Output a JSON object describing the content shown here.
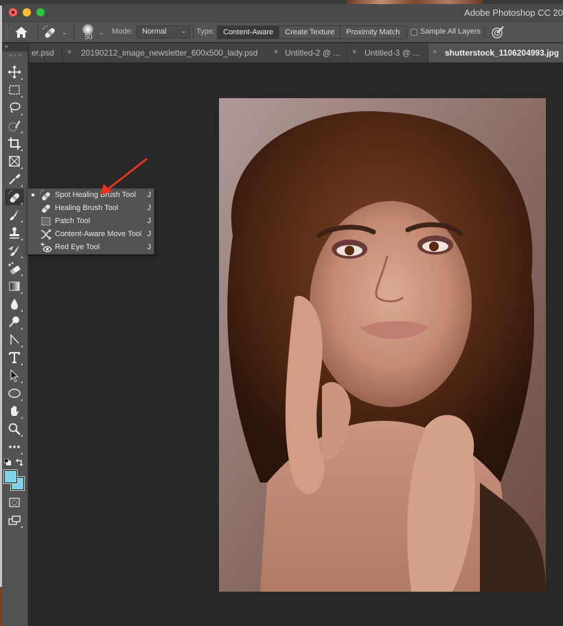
{
  "app": {
    "title": "Adobe Photoshop CC 20"
  },
  "window_controls": [
    "close",
    "minimize",
    "maximize"
  ],
  "options_bar": {
    "home_icon": "home-icon",
    "tool_preset_icon": "spot-healing-brush-icon",
    "brush_size": "50",
    "mode_label": "Mode:",
    "mode_value": "Normal",
    "type_label": "Type:",
    "type_options": [
      {
        "label": "Content-Aware",
        "selected": true
      },
      {
        "label": "Create Texture",
        "selected": false
      },
      {
        "label": "Proximity Match",
        "selected": false
      }
    ],
    "sample_all_layers": {
      "label": "Sample All Layers",
      "checked": false
    },
    "pressure_icon": "pressure-size-icon"
  },
  "tabs": [
    {
      "label": "er.psd",
      "active": false,
      "closable": false
    },
    {
      "label": "20190212_image_newsletter_600x500_lady.psd",
      "active": false,
      "closable": true
    },
    {
      "label": "Untitled-2 @ ...",
      "active": false,
      "closable": true
    },
    {
      "label": "Untitled-3 @ ...",
      "active": false,
      "closable": true
    },
    {
      "label": "shutterstock_1106204993.jpg",
      "active": true,
      "closable": true
    }
  ],
  "tools_panel": {
    "collapse_label": "»",
    "tools": [
      {
        "name": "move-tool",
        "icon": "move-icon"
      },
      {
        "name": "rectangular-marquee-tool",
        "icon": "marquee-icon"
      },
      {
        "name": "lasso-tool",
        "icon": "lasso-icon"
      },
      {
        "name": "quick-selection-tool",
        "icon": "quick-selection-icon"
      },
      {
        "name": "crop-tool",
        "icon": "crop-icon"
      },
      {
        "name": "frame-tool",
        "icon": "frame-icon"
      },
      {
        "name": "eyedropper-tool",
        "icon": "eyedropper-icon"
      },
      {
        "name": "spot-healing-brush-tool",
        "icon": "spot-healing-brush-icon",
        "selected": true
      },
      {
        "name": "brush-tool",
        "icon": "brush-icon"
      },
      {
        "name": "clone-stamp-tool",
        "icon": "stamp-icon"
      },
      {
        "name": "history-brush-tool",
        "icon": "history-brush-icon"
      },
      {
        "name": "eraser-tool",
        "icon": "eraser-icon"
      },
      {
        "name": "gradient-tool",
        "icon": "gradient-icon"
      },
      {
        "name": "blur-tool",
        "icon": "blur-drop-icon"
      },
      {
        "name": "dodge-tool",
        "icon": "dodge-icon"
      },
      {
        "name": "pen-tool",
        "icon": "pen-icon"
      },
      {
        "name": "type-tool",
        "icon": "type-icon"
      },
      {
        "name": "path-selection-tool",
        "icon": "arrow-cursor-icon"
      },
      {
        "name": "ellipse-tool",
        "icon": "ellipse-icon"
      },
      {
        "name": "hand-tool",
        "icon": "hand-icon"
      },
      {
        "name": "zoom-tool",
        "icon": "zoom-icon"
      },
      {
        "name": "edit-toolbar",
        "icon": "more-icon"
      }
    ],
    "foreground_color": "#7fd2e6",
    "background_color": "#7fd2e6",
    "quick_mask_icon": "quick-mask-icon",
    "screen_mode_icon": "screen-mode-icon"
  },
  "flyout_menu": {
    "items": [
      {
        "label": "Spot Healing Brush Tool",
        "shortcut": "J",
        "active": true,
        "icon": "spot-healing-brush-icon"
      },
      {
        "label": "Healing Brush Tool",
        "shortcut": "J",
        "active": false,
        "icon": "healing-brush-icon"
      },
      {
        "label": "Patch Tool",
        "shortcut": "J",
        "active": false,
        "icon": "patch-icon"
      },
      {
        "label": "Content-Aware Move Tool",
        "shortcut": "J",
        "active": false,
        "icon": "content-aware-move-icon"
      },
      {
        "label": "Red Eye Tool",
        "shortcut": "J",
        "active": false,
        "icon": "red-eye-icon"
      }
    ]
  },
  "annotation": {
    "type": "arrow",
    "color": "#e8321e",
    "points_to": "Spot Healing Brush Tool"
  },
  "document": {
    "image_description": "Portrait photo of a woman with curly auburn hair, hands near her face"
  }
}
